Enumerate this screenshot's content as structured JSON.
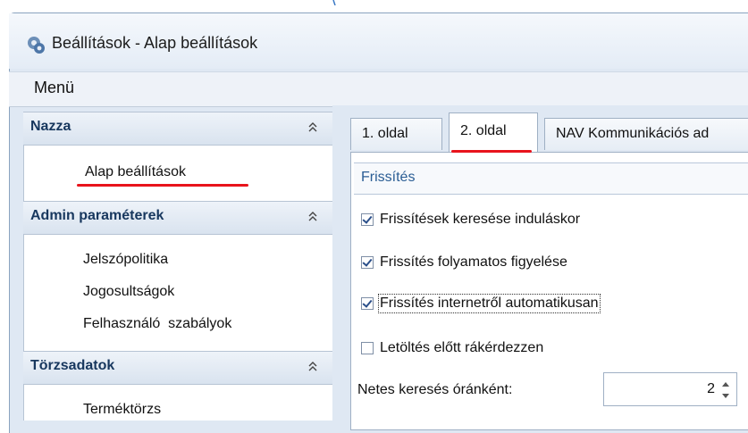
{
  "window": {
    "title": "Beállítások - Alap beállítások",
    "icon": "settings-gear-icon"
  },
  "menubar": {
    "menu_label": "Menü"
  },
  "navigation": {
    "groups": [
      {
        "title": "Nazza",
        "items": [
          "Alap beállítások"
        ]
      },
      {
        "title": "Admin paraméterek",
        "items": [
          "Jelszópolitika",
          "Jogosultságok",
          "Felhasználó  szabályok"
        ]
      },
      {
        "title": "Törzsadatok",
        "items": [
          "Terméktörzs"
        ]
      }
    ],
    "collapse_icon": "double-chevron-up-icon"
  },
  "tabs": [
    {
      "label": "1. oldal",
      "active": false
    },
    {
      "label": "2. oldal",
      "active": true
    },
    {
      "label": "NAV Kommunikációs ad",
      "active": false
    }
  ],
  "section": {
    "title": "Frissítés",
    "options": [
      {
        "label": "Frissítések keresése induláskor",
        "checked": true
      },
      {
        "label": "Frissítés folyamatos figyelése",
        "checked": true
      },
      {
        "label": "Frissítés internetről automatikusan",
        "checked": true,
        "focused": true
      },
      {
        "label": "Letöltés előtt rákérdezzen",
        "checked": false
      }
    ],
    "hourly_search": {
      "label": "Netes keresés óránként:",
      "value": "2"
    }
  },
  "colors": {
    "accent_red": "#e8141c",
    "group_title": "#17375e",
    "section_title": "#2a5d94"
  }
}
